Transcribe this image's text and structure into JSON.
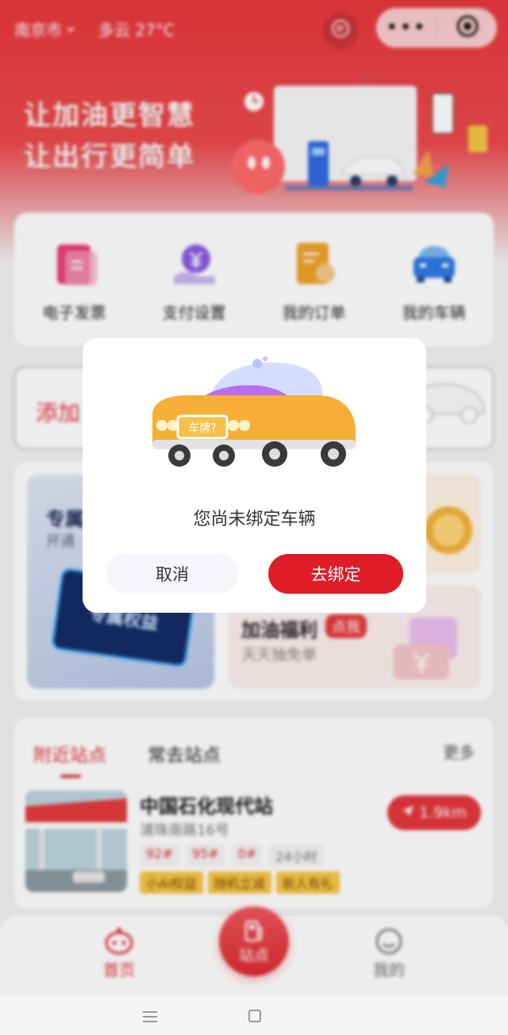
{
  "header": {
    "city": "南京市",
    "weather": "多云 27°C",
    "capsule_more": "•••",
    "slogan_line1": "让加油更智慧",
    "slogan_line2": "让出行更简单"
  },
  "quick_actions": [
    {
      "label": "电子发票",
      "icon": "invoice-icon"
    },
    {
      "label": "支付设置",
      "icon": "payment-yen-icon"
    },
    {
      "label": "我的订单",
      "icon": "order-icon"
    },
    {
      "label": "我的车辆",
      "icon": "car-icon"
    }
  ],
  "add_vehicle": {
    "label": "添加"
  },
  "promo": {
    "left_title": "专属",
    "left_sub": "开通",
    "card_text": "专属权益",
    "right_bottom_title": "加油福利",
    "right_bottom_tag": "点我",
    "right_bottom_sub": "天天抽免单"
  },
  "nearby": {
    "tabs": [
      "附近站点",
      "常去站点"
    ],
    "more": "更多",
    "station": {
      "name": "中国石化现代站",
      "address": "浦珠南路16号",
      "fuel_types": [
        "92#",
        "95#",
        "0#",
        "24小时"
      ],
      "perks": [
        "小AI权益",
        "随机立减",
        "新人有礼"
      ],
      "distance": "1.9km"
    }
  },
  "tabbar": {
    "home": "首页",
    "station": "站点",
    "mine": "我的"
  },
  "modal": {
    "plate_text": "车牌?",
    "message": "您尚未绑定车辆",
    "cancel": "取消",
    "confirm": "去绑定"
  },
  "colors": {
    "brand_red": "#e22c34",
    "hero_red": "#e8383d",
    "perk_yellow": "#f7c544",
    "confirm_red": "#e01c27"
  }
}
